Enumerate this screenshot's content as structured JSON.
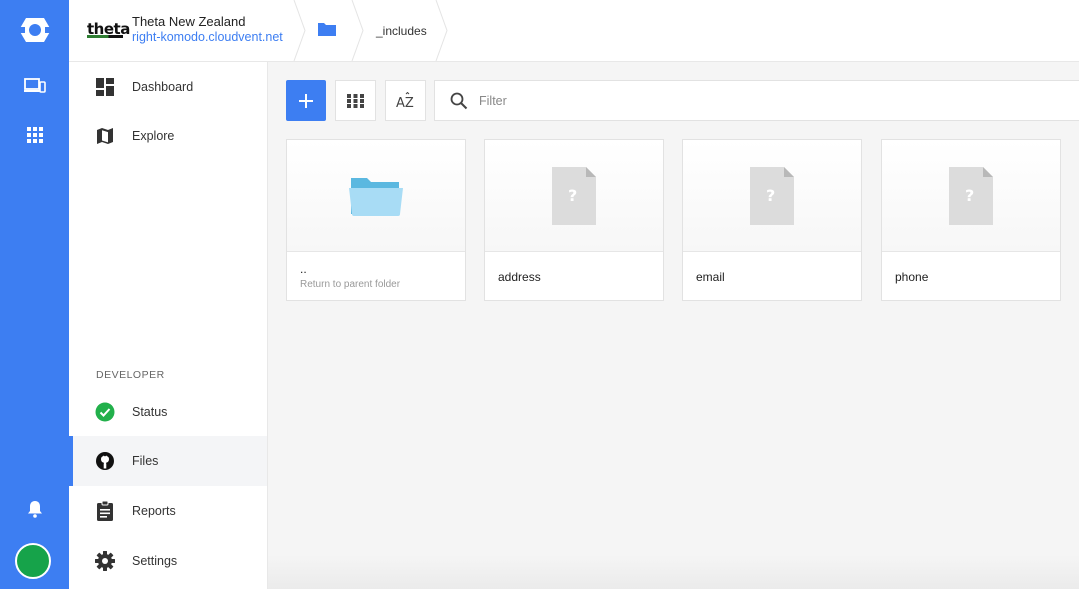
{
  "rail": {
    "icons": [
      "cloudcannon-logo-icon",
      "devices-icon",
      "apps-grid-icon",
      "bell-icon"
    ],
    "avatar_color": "#16a34a",
    "accent": "#3d7ef2"
  },
  "topbar": {
    "brand_logo": "theta",
    "site_name": "Theta New Zealand",
    "site_url": "right-komodo.cloudvent.net",
    "breadcrumb_folder_icon": "folder-icon",
    "breadcrumb_current": "_includes"
  },
  "sidebar": {
    "items": [
      {
        "label": "Dashboard",
        "icon": "dashboard-icon"
      },
      {
        "label": "Explore",
        "icon": "map-icon"
      }
    ],
    "developer_heading": "DEVELOPER",
    "developer_items": [
      {
        "label": "Status",
        "icon": "check-circle-icon"
      },
      {
        "label": "Files",
        "icon": "github-icon",
        "active": true
      },
      {
        "label": "Reports",
        "icon": "clipboard-icon"
      },
      {
        "label": "Settings",
        "icon": "gear-icon"
      }
    ]
  },
  "toolbar": {
    "add_icon": "plus-icon",
    "grid_icon": "grid-view-icon",
    "sort_icon": "sort-az-icon",
    "sort_label": "AZ",
    "filter_placeholder": "Filter",
    "filter_value": ""
  },
  "files": [
    {
      "name": "..",
      "subtitle": "Return to parent folder",
      "type": "folder"
    },
    {
      "name": "address",
      "type": "unknown-file"
    },
    {
      "name": "email",
      "type": "unknown-file"
    },
    {
      "name": "phone",
      "type": "unknown-file"
    }
  ],
  "file_unknown_glyph": "?"
}
